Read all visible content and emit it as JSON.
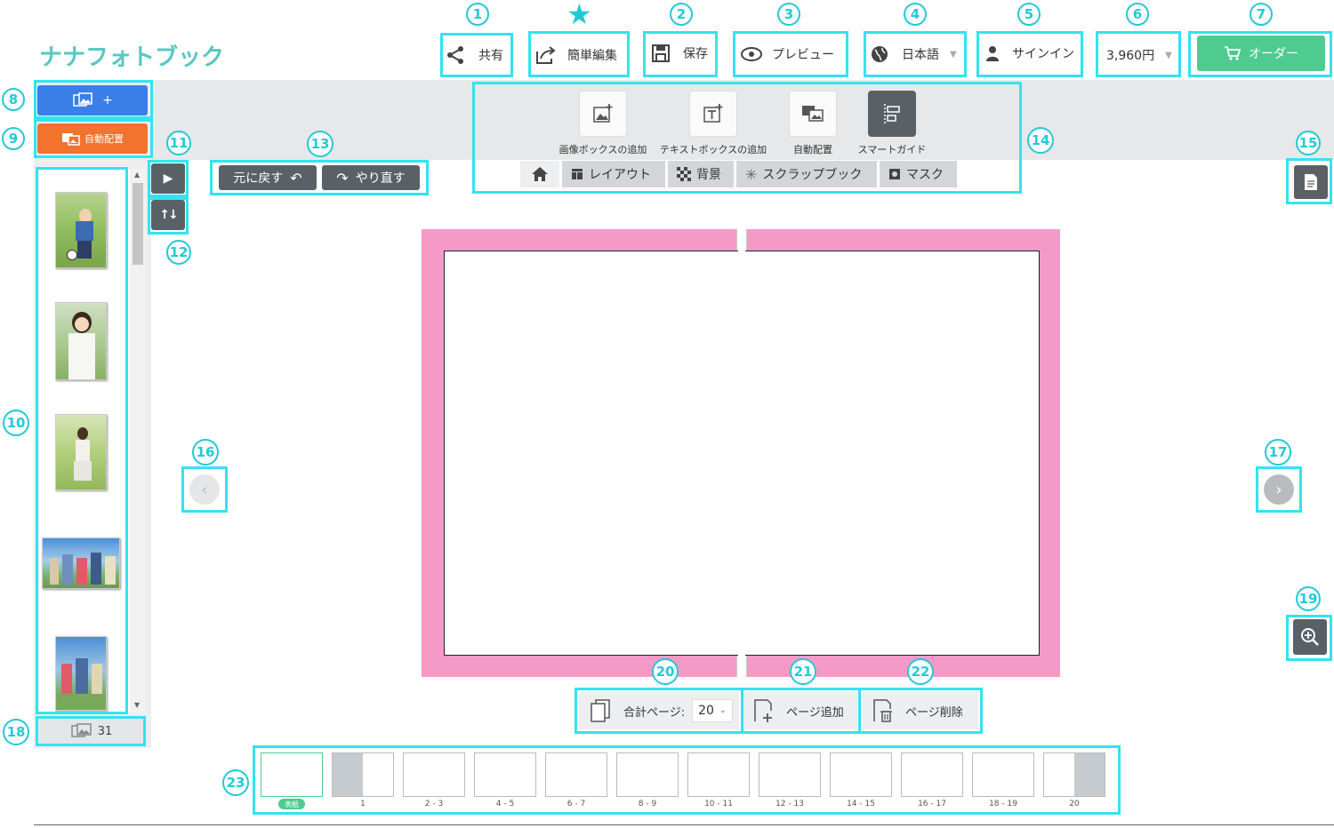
{
  "logo": "ナナフォトブック",
  "header": {
    "share": "共有",
    "easy_edit": "簡単編集",
    "save": "保存",
    "preview": "プレビュー",
    "language": "日本語",
    "signin": "サインイン",
    "price": "3,960円",
    "order": "オーダー"
  },
  "left": {
    "auto_layout": "自動配置",
    "photo_count": "31"
  },
  "undo": {
    "undo": "元に戻す",
    "redo": "やり直す"
  },
  "toolbar": {
    "tools": [
      "画像ボックスの追加",
      "テキストボックスの追加",
      "自動配置",
      "スマートガイド"
    ],
    "tabs": [
      "レイアウト",
      "背景",
      "スクラップブック",
      "マスク"
    ]
  },
  "pages": {
    "total_label": "合計ページ:",
    "total_value": "20",
    "add": "ページ追加",
    "delete": "ページ削除"
  },
  "page_strip": {
    "cover_badge": "表紙",
    "labels": [
      "1",
      "2 - 3",
      "4 - 5",
      "6 - 7",
      "8 - 9",
      "10 - 11",
      "12 - 13",
      "14 - 15",
      "16 - 17",
      "18 - 19",
      "20"
    ]
  },
  "callouts": [
    "1",
    "2",
    "3",
    "4",
    "5",
    "6",
    "7",
    "8",
    "9",
    "10",
    "11",
    "12",
    "13",
    "14",
    "15",
    "16",
    "17",
    "18",
    "19",
    "20",
    "21",
    "22",
    "23"
  ],
  "colors": {
    "highlight": "#33e3f0",
    "order": "#4ecb8e",
    "add_photo": "#3a7ee8",
    "auto_layout": "#f2732e",
    "canvas": "#f59ac6"
  }
}
